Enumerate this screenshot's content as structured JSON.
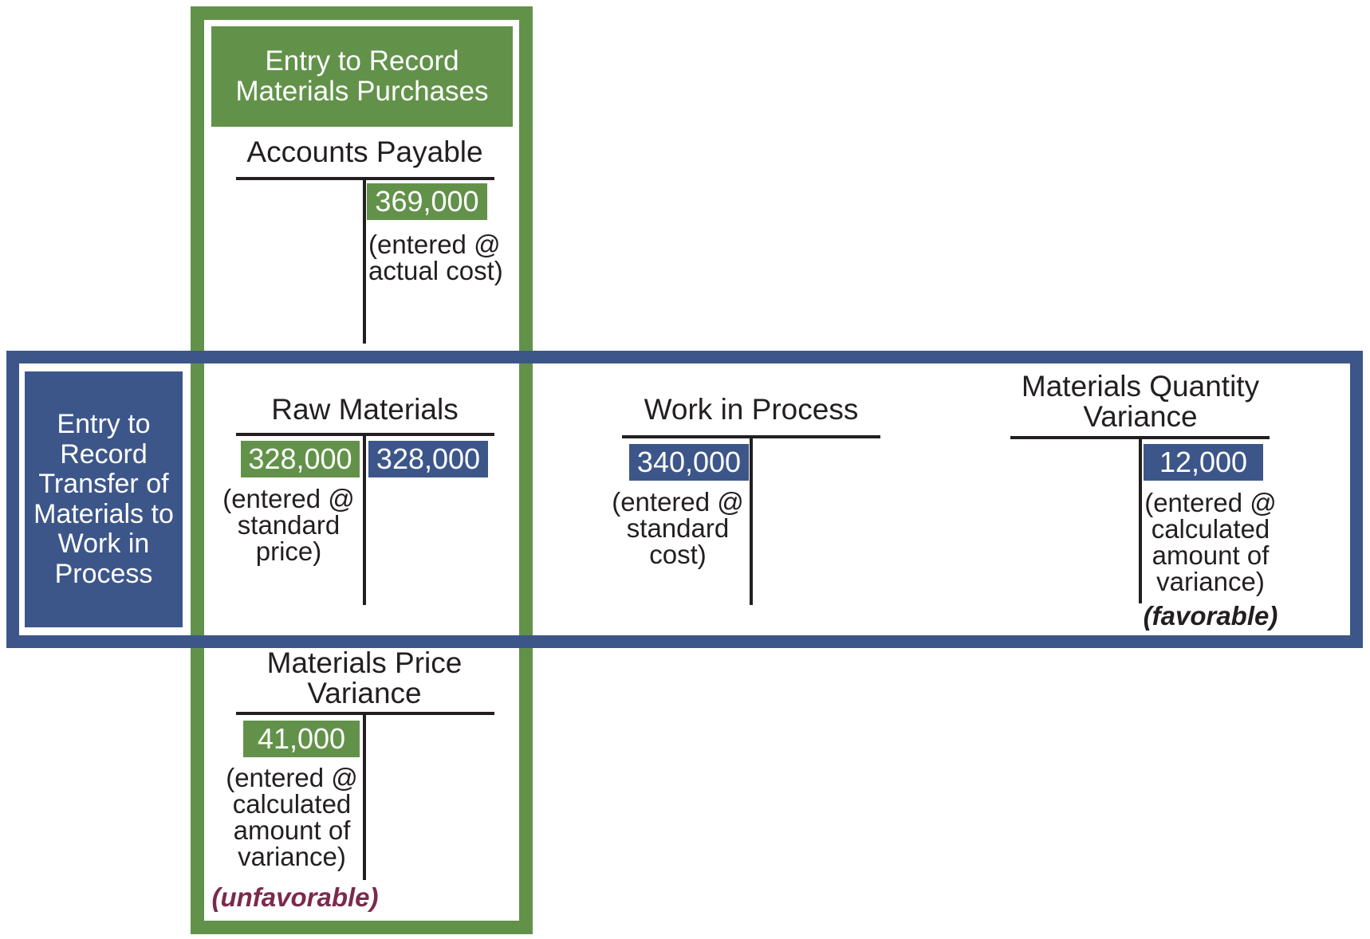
{
  "colors": {
    "purchase_entry": "#62924a",
    "transfer_entry": "#3d5689",
    "unfavorable": "#7b2a4c",
    "text": "#231f20"
  },
  "entries": {
    "purchase": {
      "label": "Entry to Record\nMaterials Purchases"
    },
    "transfer": {
      "label": "Entry to\nRecord\nTransfer of\nMaterials to\nWork in\nProcess"
    }
  },
  "accounts": {
    "accounts_payable": {
      "title": "Accounts Payable",
      "credit": {
        "amount": "369,000",
        "entry": "purchase"
      },
      "note": "(entered @\nactual cost)"
    },
    "raw_materials": {
      "title": "Raw Materials",
      "debit": {
        "amount": "328,000",
        "entry": "purchase"
      },
      "credit": {
        "amount": "328,000",
        "entry": "transfer"
      },
      "note": "(entered @\nstandard\nprice)"
    },
    "work_in_process": {
      "title": "Work in Process",
      "debit": {
        "amount": "340,000",
        "entry": "transfer"
      },
      "note": "(entered @\nstandard\ncost)"
    },
    "materials_quantity_variance": {
      "title": "Materials Quantity\nVariance",
      "credit": {
        "amount": "12,000",
        "entry": "transfer"
      },
      "note": "(entered @\ncalculated\namount of\nvariance)",
      "flag": "(favorable)"
    },
    "materials_price_variance": {
      "title": "Materials Price\nVariance",
      "debit": {
        "amount": "41,000",
        "entry": "purchase"
      },
      "note": "(entered @\ncalculated\namount of\nvariance)",
      "flag": "(unfavorable)"
    }
  }
}
